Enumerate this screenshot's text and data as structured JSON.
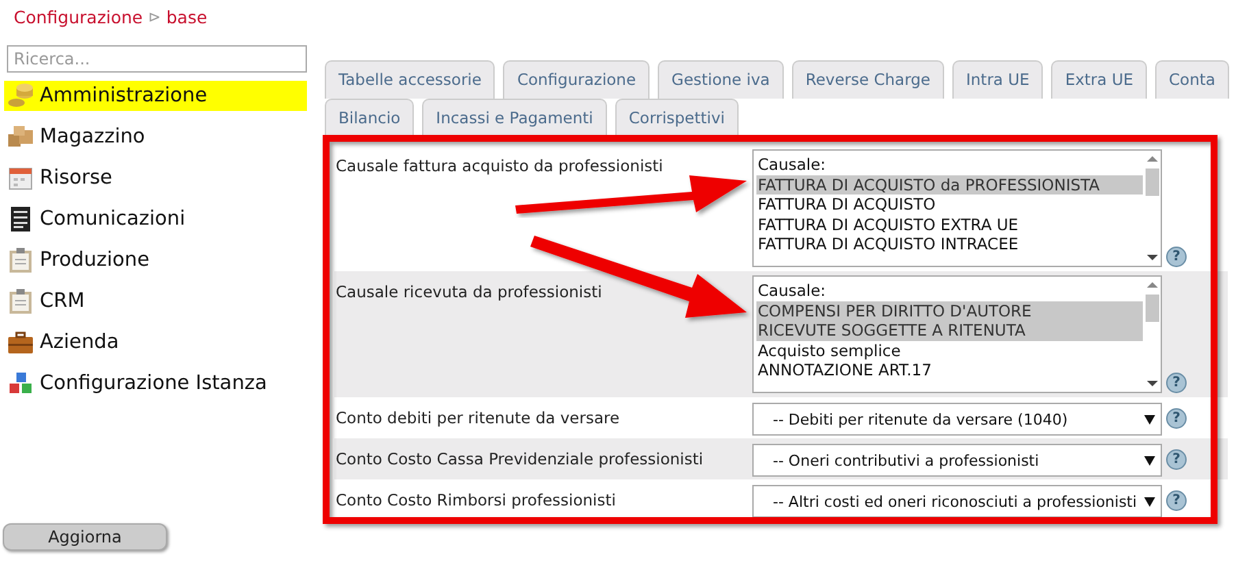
{
  "breadcrumb": {
    "items": [
      "Configurazione",
      "base"
    ],
    "separator": "⊳"
  },
  "sidebar": {
    "search": {
      "placeholder": "Ricerca..."
    },
    "items": [
      {
        "label": "Amministrazione",
        "selected": true
      },
      {
        "label": "Magazzino",
        "selected": false
      },
      {
        "label": "Risorse",
        "selected": false
      },
      {
        "label": "Comunicazioni",
        "selected": false
      },
      {
        "label": "Produzione",
        "selected": false
      },
      {
        "label": "CRM",
        "selected": false
      },
      {
        "label": "Azienda",
        "selected": false
      },
      {
        "label": "Configurazione Istanza",
        "selected": false
      }
    ],
    "button": "Aggiorna"
  },
  "tabs": [
    [
      {
        "label": "Tabelle accessorie",
        "selected": false
      },
      {
        "label": "Configurazione",
        "selected": false
      },
      {
        "label": "Gestione iva",
        "selected": false
      },
      {
        "label": "Reverse Charge",
        "selected": false
      },
      {
        "label": "Intra UE",
        "selected": false
      },
      {
        "label": "Extra UE",
        "selected": false
      },
      {
        "label": "Conta",
        "selected": false
      }
    ],
    [
      {
        "label": "Bilancio",
        "selected": false
      },
      {
        "label": "Incassi e Pagamenti",
        "selected": false
      },
      {
        "label": "Corrispettivi",
        "selected": false
      }
    ]
  ],
  "form": [
    {
      "kind": "listbox",
      "label": "Causale fattura acquisto da professionisti",
      "header": "Causale:",
      "options": [
        {
          "label": "FATTURA DI ACQUISTO da PROFESSIONISTA",
          "selected": true
        },
        {
          "label": "FATTURA DI ACQUISTO",
          "selected": false
        },
        {
          "label": "FATTURA DI ACQUISTO EXTRA UE",
          "selected": false
        },
        {
          "label": "FATTURA DI ACQUISTO INTRACEE",
          "selected": false
        }
      ],
      "help": "?"
    },
    {
      "kind": "listbox",
      "label": "Causale ricevuta da professionisti",
      "header": "Causale:",
      "options": [
        {
          "label": "COMPENSI PER DIRITTO D'AUTORE",
          "selected": true
        },
        {
          "label": "RICEVUTE SOGGETTE A RITENUTA",
          "selected": true
        },
        {
          "label": "Acquisto semplice",
          "selected": false
        },
        {
          "label": "ANNOTAZIONE ART.17",
          "selected": false
        }
      ],
      "help": "?"
    },
    {
      "kind": "select",
      "label": "Conto debiti per ritenute da versare",
      "value": "-- Debiti per ritenute da versare (1040)",
      "help": "?"
    },
    {
      "kind": "select",
      "label": "Conto Costo Cassa Previdenziale professionisti",
      "value": "-- Oneri contributivi a professionisti",
      "help": "?"
    },
    {
      "kind": "select",
      "label": "Conto Costo Rimborsi professionisti",
      "value": "-- Altri costi ed oneri riconosciuti a professionisti",
      "help": "?"
    }
  ]
}
